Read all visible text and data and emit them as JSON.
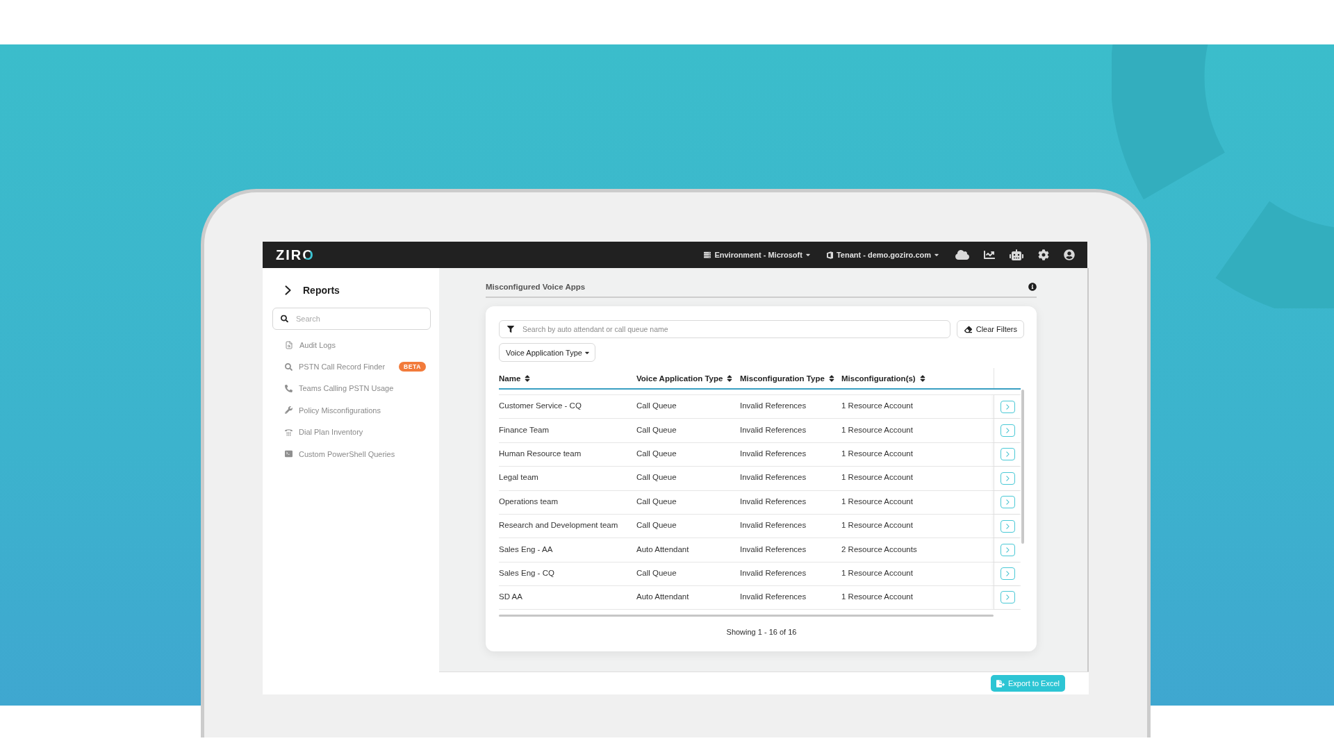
{
  "top_bar": {
    "logo": "ZIRO",
    "menus": [
      {
        "label": "Environment - Microsoft"
      },
      {
        "label": "Tenant - demo.goziro.com"
      }
    ]
  },
  "sidebar": {
    "title": "Reports",
    "search": {
      "placeholder": "Search"
    },
    "items": [
      {
        "label": "Audit Logs"
      },
      {
        "label": "PSTN Call Record Finder",
        "badge": "BETA"
      },
      {
        "label": "Teams Calling PSTN Usage"
      },
      {
        "label": "Policy Misconfigurations"
      },
      {
        "label": "Dial Plan Inventory"
      },
      {
        "label": "Custom PowerShell Queries"
      }
    ]
  },
  "page": {
    "title": "Misconfigured Voice Apps"
  },
  "filters": {
    "search": {
      "placeholder": "Search by auto attendant or call queue name"
    },
    "clear_button": "Clear Filters",
    "type_dropdown": "Voice Application Type"
  },
  "table": {
    "columns": [
      "Name",
      "Voice Application Type",
      "Misconfiguration Type",
      "Misconfiguration(s)"
    ],
    "rows": [
      [
        "Customer Service - CQ",
        "Call Queue",
        "Invalid References",
        "1 Resource Account"
      ],
      [
        "Finance Team",
        "Call Queue",
        "Invalid References",
        "1 Resource Account"
      ],
      [
        "Human Resource team",
        "Call Queue",
        "Invalid References",
        "1 Resource Account"
      ],
      [
        "Legal team",
        "Call Queue",
        "Invalid References",
        "1 Resource Account"
      ],
      [
        "Operations team",
        "Call Queue",
        "Invalid References",
        "1 Resource Account"
      ],
      [
        "Research and Development team",
        "Call Queue",
        "Invalid References",
        "1 Resource Account"
      ],
      [
        "Sales Eng - AA",
        "Auto Attendant",
        "Invalid References",
        "2 Resource Accounts"
      ],
      [
        "Sales Eng - CQ",
        "Call Queue",
        "Invalid References",
        "1 Resource Account"
      ],
      [
        "SD AA",
        "Auto Attendant",
        "Invalid References",
        "1 Resource Account"
      ]
    ]
  },
  "pagination": "Showing 1 - 16 of 16",
  "footer": {
    "export_button": "Export to Excel"
  }
}
